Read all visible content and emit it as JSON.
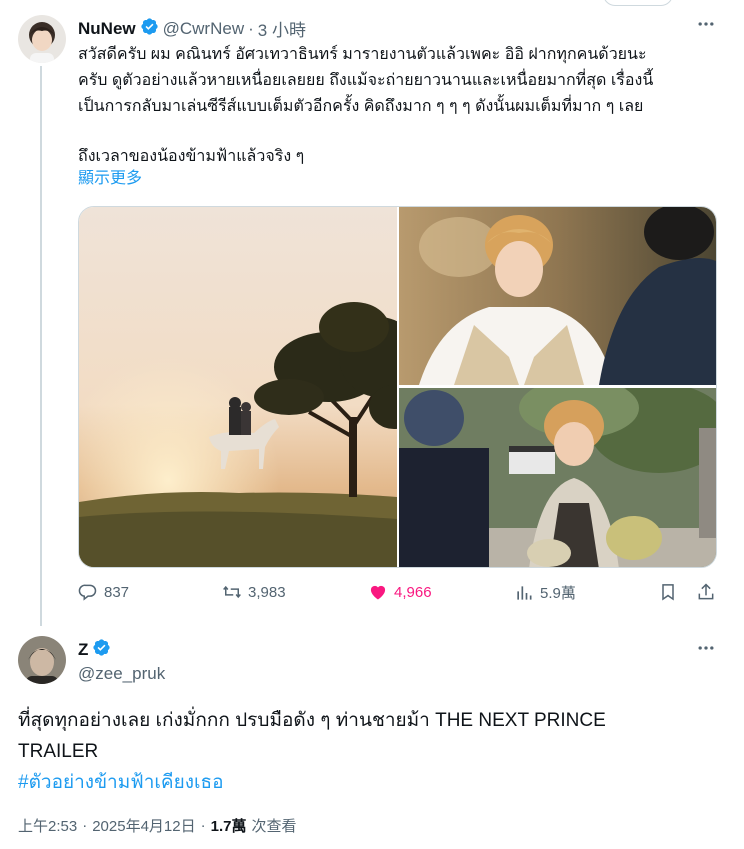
{
  "tweet1": {
    "name": "NuNew",
    "handle": "@CwrNew",
    "dot": "·",
    "time": "3 小時",
    "text_lines": [
      "สวัสดีครับ ผม คณินทร์ อัศวเทวาธินทร์ มารายงานตัวแล้วเพคะ อิอิ ฝากทุกคนด้วยนะ",
      "ครับ ดูตัวอย่างแล้วหายเหนื่อยเลยยย ถึงแม้จะถ่ายยาวนานและเหนื่อยมากที่สุด เรื่องนี้",
      "เป็นการกลับมาเล่นซีรีส์แบบเต็มตัวอีกครั้ง คิดถึงมาก ๆ ๆ ๆ ดังนั้นผมเต็มที่มาก ๆ เลย"
    ],
    "text_line4": "ถึงเวลาของน้องข้ามฟ้าแล้วจริง ๆ",
    "show_more": "顯示更多",
    "actions": {
      "reply": "837",
      "retweet": "3,983",
      "like": "4,966",
      "views": "5.9萬"
    },
    "colors": {
      "like": "#f91880",
      "verified": "#1d9bf0"
    }
  },
  "tweet2": {
    "name": "Z",
    "handle": "@zee_pruk",
    "text_line1": "ที่สุดทุกอย่างเลย เก่งมั่กกก ปรบมือดัง ๆ ท่านชายม้า THE NEXT PRINCE",
    "text_line2": "TRAILER",
    "hashtag": "#ตัวอย่างข้ามฟ้าเคียงเธอ",
    "footer": {
      "time": "上午2:53",
      "dot1": "·",
      "date": "2025年4月12日",
      "dot2": "·",
      "views_count": "1.7萬",
      "views_label": "次查看"
    }
  },
  "icons": {
    "more": "more-dots-icon",
    "reply": "reply-icon",
    "retweet": "retweet-icon",
    "like": "heart-icon",
    "views": "views-chart-icon",
    "bookmark": "bookmark-icon",
    "share": "share-icon"
  }
}
